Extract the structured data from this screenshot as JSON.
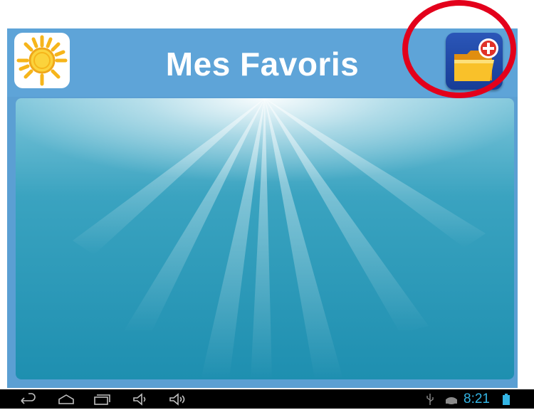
{
  "header": {
    "title": "Mes Favoris",
    "left_icon": "sun-icon",
    "right_button_icon": "folder-add-icon"
  },
  "annotation": {
    "shape": "circle",
    "color": "#e3001b"
  },
  "statusbar": {
    "nav_icons": [
      "back-icon",
      "home-icon",
      "recent-apps-icon",
      "volume-down-icon",
      "volume-up-icon"
    ],
    "status_icons": [
      "usb-icon",
      "android-debug-icon",
      "battery-icon"
    ],
    "time": "8:21",
    "accent_color": "#33b5e5"
  },
  "colors": {
    "header_blue": "#5ea4d8",
    "content_teal": "#1e8fb0"
  }
}
